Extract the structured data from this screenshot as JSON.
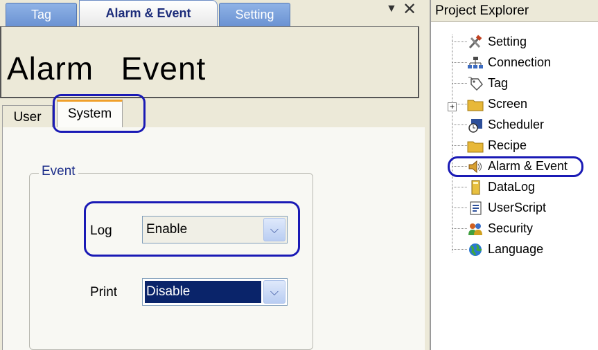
{
  "tabs": {
    "items": [
      {
        "label": "Tag"
      },
      {
        "label": "Alarm & Event"
      },
      {
        "label": "Setting"
      }
    ],
    "active": "Alarm & Event"
  },
  "panel_controls": {
    "pin_icon": "pin-dropdown-icon",
    "pin_glyph": "▼",
    "close_glyph": "✕"
  },
  "page": {
    "title": "Alarm  Event"
  },
  "subtabs": {
    "items": [
      {
        "label": "User"
      },
      {
        "label": "System"
      }
    ],
    "active": "System"
  },
  "event_group": {
    "legend": "Event",
    "log": {
      "label": "Log",
      "value": "Enable"
    },
    "print": {
      "label": "Print",
      "value": "Disable"
    },
    "dropdown_arrow": "⌄"
  },
  "project_explorer": {
    "title": "Project Explorer",
    "expand_glyph": "+",
    "items": [
      {
        "label": "Setting",
        "icon": "tools-icon"
      },
      {
        "label": "Connection",
        "icon": "network-icon"
      },
      {
        "label": "Tag",
        "icon": "tag-icon"
      },
      {
        "label": "Screen",
        "icon": "folder-icon"
      },
      {
        "label": "Scheduler",
        "icon": "scheduler-icon"
      },
      {
        "label": "Recipe",
        "icon": "folder-icon"
      },
      {
        "label": "Alarm & Event",
        "icon": "alarm-speaker-icon"
      },
      {
        "label": "DataLog",
        "icon": "datalog-icon"
      },
      {
        "label": "UserScript",
        "icon": "script-icon"
      },
      {
        "label": "Security",
        "icon": "users-icon"
      },
      {
        "label": "Language",
        "icon": "globe-icon"
      }
    ],
    "selected": "Alarm & Event"
  },
  "colors": {
    "highlight": "#1a1ab5",
    "tab_blue": "#6a92d2",
    "selection": "#0a246a"
  }
}
